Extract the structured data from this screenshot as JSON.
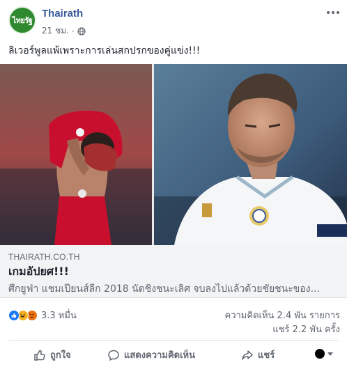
{
  "post": {
    "avatar_text": "ไทยรัฐ",
    "page_name": "Thairath",
    "timestamp": "21 ชม.",
    "separator": "·",
    "text": "ลิเวอร์พูลแพ้เพราะการเล่นสกปรกของคู่แข่ง!!!"
  },
  "link_preview": {
    "domain": "THAIRATH.CO.TH",
    "title": "เกมอัปยศ!!!",
    "description": "ศึกยูฟ่า แชมเปียนส์ลีก 2018 นัดชิงชนะเลิศ จบลงไปแล้วด้วยชัยชนะของ..."
  },
  "stats": {
    "reactions_count": "3.3 หมื่น",
    "comments": "ความคิดเห็น 2.4 พัน รายการ",
    "shares": "แชร์ 2.2 พัน ครั้ง"
  },
  "actions": {
    "like": "ถูกใจ",
    "comment": "แสดงความคิดเห็น",
    "share": "แชร์"
  },
  "colors": {
    "link_blue": "#385898",
    "brand_green": "#2f8a2f",
    "like_blue": "#1877f2",
    "secondary_text": "#606770"
  }
}
